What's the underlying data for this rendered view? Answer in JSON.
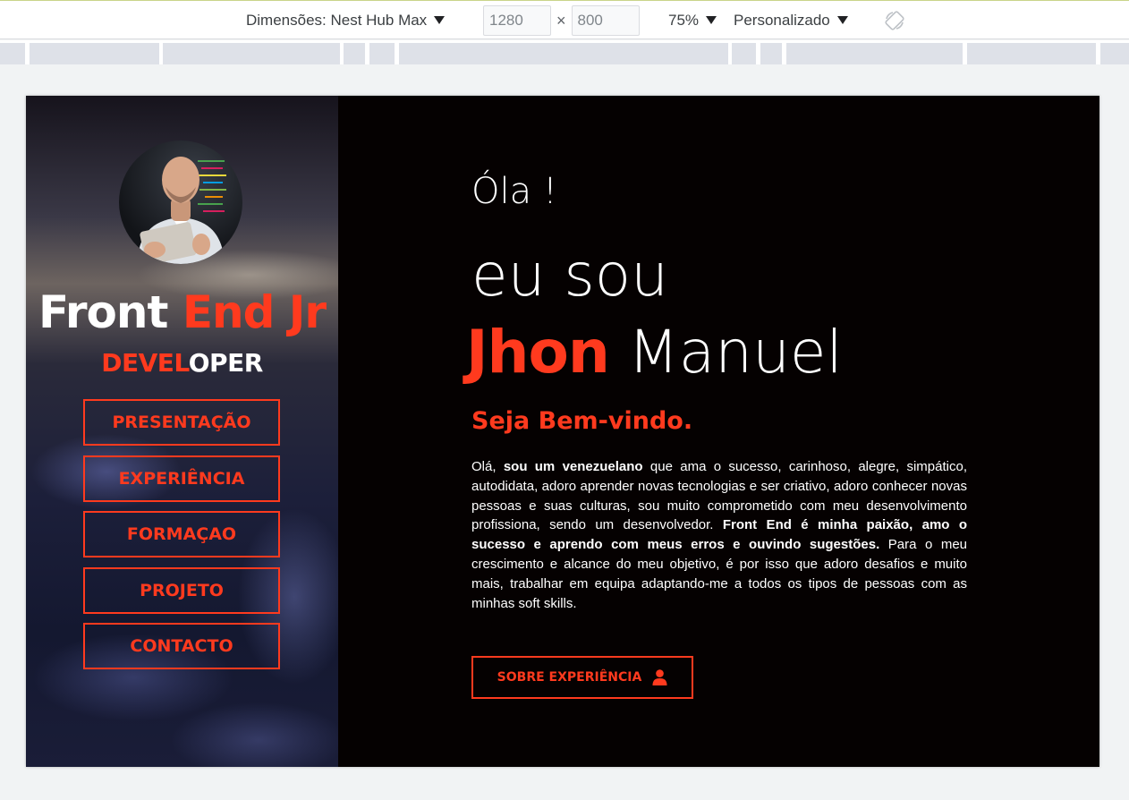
{
  "devtools": {
    "dimensions_label": "Dimensões: Nest Hub Max",
    "width": "1280",
    "times": "×",
    "height": "800",
    "zoom": "75%",
    "throttle": "Personalizado",
    "rotate_icon": "rotate-icon"
  },
  "site": {
    "brand_title_a": "Front",
    "brand_title_b": "End Jr",
    "brand_sub_a": "DEVEL",
    "brand_sub_b": "OPER",
    "nav": [
      "PRESENTAÇÃO",
      "EXPERIÊNCIA",
      "FORMAÇAO",
      "PROJETO",
      "CONTACTO"
    ],
    "greeting": "Óla !",
    "iam": "eu sou",
    "first_name": "Jhon",
    "last_name": "Manuel",
    "welcome": "Seja Bem-vindo.",
    "bio": {
      "p1": "Olá,",
      "b1": "sou um venezuelano",
      "p2": "que ama o sucesso, carinhoso, alegre, simpático, autodidata, adoro aprender novas tecnologias e ser criativo, adoro conhecer novas pessoas e suas culturas, sou muito comprometido com meu desenvolvimento profissiona, sendo um desenvolvedor.",
      "b2": "Front End é minha paixão, amo o sucesso e aprendo com meus erros e ouvindo sugestões.",
      "p3": "Para o meu crescimento e alcance do meu objetivo, é por isso que adoro desafios e muito mais, trabalhar em equipa adaptando-me a todos os tipos de pessoas com as minhas soft skills."
    },
    "cta_label": "SOBRE EXPERIÊNCIA",
    "cta_icon": "user-icon"
  },
  "colors": {
    "accent": "#ff3a1e",
    "background": "#050101",
    "text": "#ffffff"
  }
}
